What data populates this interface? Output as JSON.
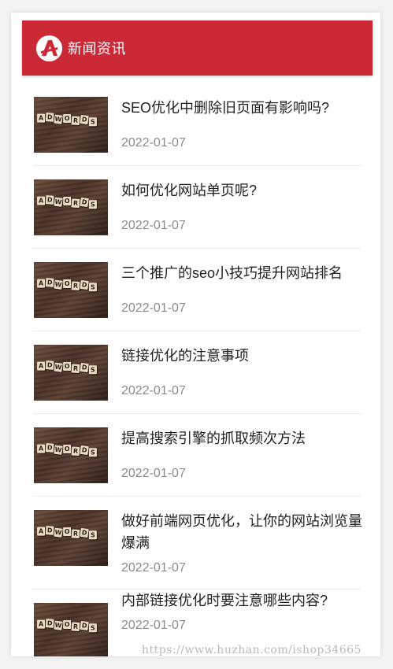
{
  "colors": {
    "header_bg": "#cc2937",
    "title_text": "#222222",
    "date_text": "#8b8b8b"
  },
  "header": {
    "title": "新闻资讯",
    "logo_icon": "a-letter-logo-icon",
    "logo_letter": "A"
  },
  "news": [
    {
      "title": "SEO优化中删除旧页面有影响吗?",
      "date": "2022-01-07",
      "thumb_letters": [
        "A",
        "D",
        "W",
        "O",
        "R",
        "D",
        "S"
      ]
    },
    {
      "title": "如何优化网站单页呢?",
      "date": "2022-01-07",
      "thumb_letters": [
        "A",
        "D",
        "W",
        "O",
        "R",
        "D",
        "S"
      ]
    },
    {
      "title": "三个推广的seo小技巧提升网站排名",
      "date": "2022-01-07",
      "thumb_letters": [
        "A",
        "D",
        "W",
        "O",
        "R",
        "D",
        "S"
      ]
    },
    {
      "title": "链接优化的注意事项",
      "date": "2022-01-07",
      "thumb_letters": [
        "A",
        "D",
        "W",
        "O",
        "R",
        "D",
        "S"
      ]
    },
    {
      "title": "提高搜索引擎的抓取频次方法",
      "date": "2022-01-07",
      "thumb_letters": [
        "A",
        "D",
        "W",
        "O",
        "R",
        "D",
        "S"
      ]
    },
    {
      "title": "做好前端网页优化，让你的网站浏览量爆满",
      "date": "2022-01-07",
      "thumb_letters": [
        "A",
        "D",
        "W",
        "O",
        "R",
        "D",
        "S"
      ]
    },
    {
      "title": "内部链接优化时要注意哪些内容?",
      "date": "2022-01-07",
      "thumb_letters": [
        "A",
        "D",
        "W",
        "O",
        "R",
        "D",
        "S"
      ]
    }
  ],
  "watermark": "https://www.huzhan.com/ishop34665"
}
